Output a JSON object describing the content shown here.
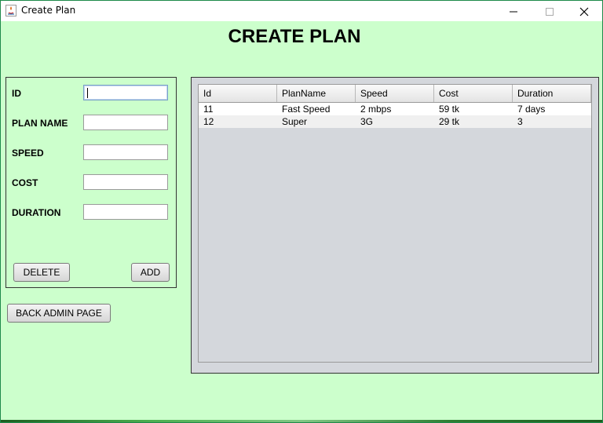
{
  "window": {
    "title": "Create Plan"
  },
  "page": {
    "heading": "CREATE PLAN"
  },
  "form": {
    "fields": [
      {
        "label": "ID",
        "value": ""
      },
      {
        "label": "PLAN NAME",
        "value": ""
      },
      {
        "label": "SPEED",
        "value": ""
      },
      {
        "label": "COST",
        "value": ""
      },
      {
        "label": "DURATION",
        "value": ""
      }
    ],
    "delete_label": "DELETE",
    "add_label": "ADD"
  },
  "nav": {
    "back_label": "BACK ADMIN PAGE"
  },
  "table": {
    "columns": [
      "Id",
      "PlanName",
      "Speed",
      "Cost",
      "Duration"
    ],
    "rows": [
      [
        "11",
        "Fast Speed",
        "2 mbps",
        "59 tk",
        "7 days"
      ],
      [
        "12",
        "Super",
        "3G",
        "29 tk",
        "3"
      ]
    ]
  },
  "colors": {
    "background": "#ccffcc",
    "table_area": "#d4d7dc"
  }
}
